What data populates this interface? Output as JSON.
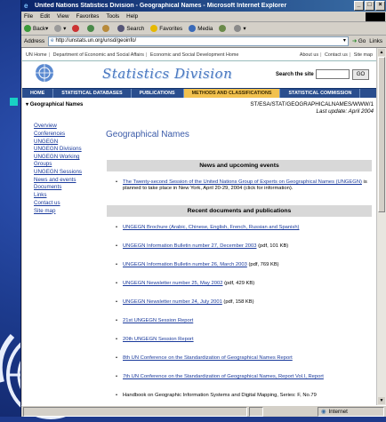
{
  "window": {
    "title": "United Nations Statistics Division - Geographical Names - Microsoft Internet Explorer",
    "menu": [
      "File",
      "Edit",
      "View",
      "Favorites",
      "Tools",
      "Help"
    ],
    "toolbar": {
      "back": "Back",
      "search": "Search",
      "favorites": "Favorites",
      "media": "Media"
    },
    "address_label": "Address",
    "address_value": "http://unstats.un.org/unsd/geoinfo/",
    "go_label": "Go",
    "links_label": "Links",
    "status_zone": "Internet"
  },
  "page": {
    "topnav": {
      "left": [
        "UN Home",
        "Department of Economic and Social Affairs",
        "Economic and Social Development Home"
      ],
      "right": [
        "About us",
        "Contact us",
        "Site map"
      ]
    },
    "brand": "Statistics Division",
    "search_label": "Search the site",
    "search_go": "GO",
    "nav": [
      "HOME",
      "STATISTICAL DATABASES",
      "PUBLICATIONS",
      "METHODS AND CLASSIFICATIONS",
      "STATISTICAL COMMISSION"
    ],
    "side_title": "Geographical Names",
    "path": "ST/ESA/STAT/GEOGRAPHICALNAMES/WWW/1",
    "last_update": "Last update: April 2004",
    "sidebar": [
      "Overview",
      "Conferences",
      "UNGEGN",
      "UNGEGN Divisions",
      "UNGEGN Working Groups",
      "UNGEGN Sessions",
      "News and events",
      "Documents",
      "Links",
      "Contact us",
      "Site map"
    ],
    "title": "Geographical Names",
    "news_heading": "News and upcoming events",
    "news_link": "The Twenty-second Session of the United Nations Group of Experts on Geographical Names (UNGEGN)",
    "news_text": " is planned to take place in New York, April 20-29, 2004 (click for information).",
    "docs_heading": "Recent documents and publications",
    "docs": [
      {
        "link": "UNGEGN Brochure (Arabic, Chinese, English, French, Russian and Spanish)",
        "meta": ""
      },
      {
        "link": "UNGEGN Information Bulletin number 27, December 2003",
        "meta": " (pdf, 101 KB)"
      },
      {
        "link": "UNGEGN Information Bulletin number 26, March 2003",
        "meta": " (pdf, 769 KB)"
      },
      {
        "link": "UNGEGN Newsletter number 25, May 2002",
        "meta": " (pdf, 429 KB)"
      },
      {
        "link": "UNGEGN Newsletter number 24, July 2001",
        "meta": " (pdf, 158 KB)"
      },
      {
        "link": "21st UNGEGN Session Report",
        "meta": ""
      },
      {
        "link": "20th UNGEGN Session Report",
        "meta": ""
      },
      {
        "link": "8th UN Conference on the Standardization of Geographical Names Report",
        "meta": ""
      },
      {
        "link": "7th UN Conference on the Standardization of Geographical Names, Report Vol.I, Report",
        "meta": ""
      },
      {
        "link": "",
        "meta": "Handbook on Geographic Information Systems and Digital Mapping, Series: F, No.79"
      }
    ]
  },
  "colors": {
    "desktop": "#1e3a8c",
    "teal_marker": "#19d1c4",
    "navbar": "#2a4e8e",
    "navbar_active": "#f2c14e",
    "link": "#1a3a9c"
  }
}
